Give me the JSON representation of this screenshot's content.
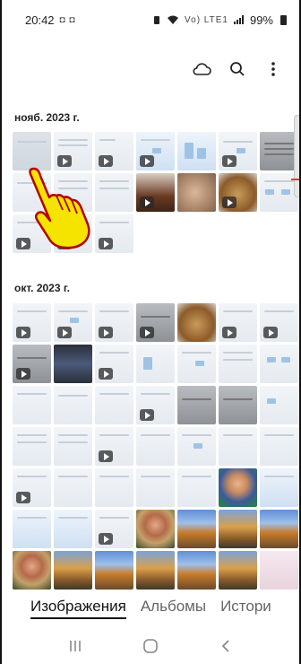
{
  "status": {
    "time": "20:42",
    "left_icons": "◘ ◘",
    "right_icons": "Vo) LTE1",
    "battery": "99%"
  },
  "toolbar": {
    "cloud_icon": "cloud-icon",
    "search_icon": "search-icon",
    "more_icon": "more-vert-icon"
  },
  "sections": [
    {
      "title": "нояб. 2023 г."
    },
    {
      "title": "окт. 2023 г."
    }
  ],
  "tabs": [
    {
      "label": "Изображения",
      "active": true
    },
    {
      "label": "Альбомы",
      "active": false
    },
    {
      "label": "Истори",
      "active": false
    }
  ],
  "navbar": {
    "recents_icon": "recents-icon",
    "home_icon": "home-icon",
    "back_icon": "back-icon"
  },
  "colors": {
    "accent": "#e33333",
    "pointer": "#f5e400"
  }
}
